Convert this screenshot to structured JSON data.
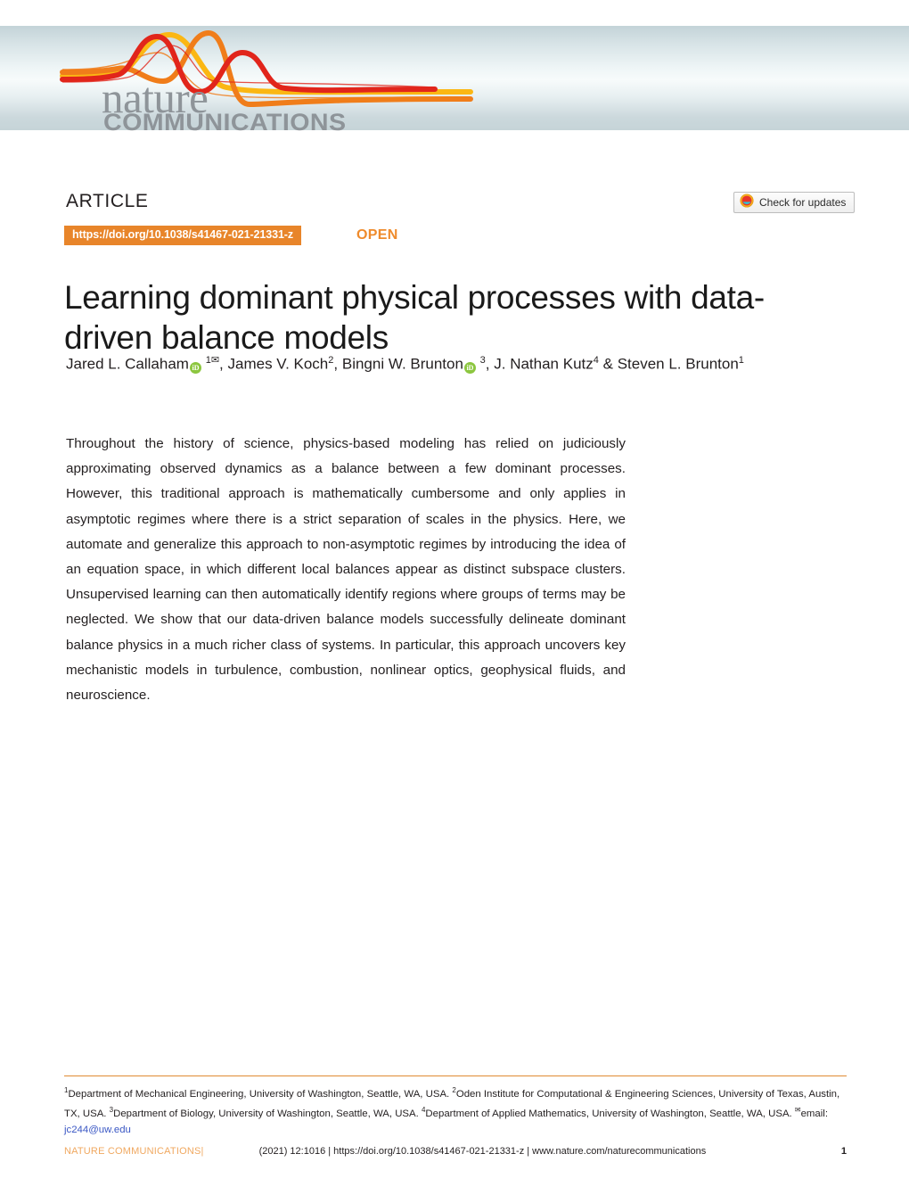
{
  "masthead": {
    "brand_primary": "nature",
    "brand_secondary": "COMMUNICATIONS",
    "wave_colors": [
      "#e1251b",
      "#f07d1a",
      "#fbb713"
    ]
  },
  "header": {
    "article_label": "ARTICLE",
    "doi_badge": "https://doi.org/10.1038/s41467-021-21331-z",
    "access_label": "OPEN",
    "check_updates_label": "Check for updates",
    "badge_color": "#e8852a",
    "open_color": "#ef8b2c"
  },
  "title": "Learning dominant physical processes with data-driven balance models",
  "authors": {
    "list": [
      {
        "name": "Jared L. Callaham",
        "orcid": true,
        "affiliations": "1",
        "corresponding": true
      },
      {
        "name": "James V. Koch",
        "orcid": false,
        "affiliations": "2",
        "corresponding": false
      },
      {
        "name": "Bingni W. Brunton",
        "orcid": true,
        "affiliations": "3",
        "corresponding": false
      },
      {
        "name": "J. Nathan Kutz",
        "orcid": false,
        "affiliations": "4",
        "corresponding": false
      },
      {
        "name": "Steven L. Brunton",
        "orcid": false,
        "affiliations": "1",
        "corresponding": false
      }
    ],
    "orcid_glyph": "iD",
    "envelope_glyph": "✉",
    "orcid_color": "#8cc63f"
  },
  "abstract": "Throughout the history of science, physics-based modeling has relied on judiciously approximating observed dynamics as a balance between a few dominant processes. However, this traditional approach is mathematically cumbersome and only applies in asymptotic regimes where there is a strict separation of scales in the physics. Here, we automate and generalize this approach to non-asymptotic regimes by introducing the idea of an equation space, in which different local balances appear as distinct subspace clusters. Unsupervised learning can then automatically identify regions where groups of terms may be neglected. We show that our data-driven balance models successfully delineate dominant balance physics in a much richer class of systems. In particular, this approach uncovers key mechanistic models in turbulence, combustion, nonlinear optics, geophysical fluids, and neuroscience.",
  "affiliations": {
    "entries": [
      {
        "marker": "1",
        "text": "Department of Mechanical Engineering, University of Washington, Seattle, WA, USA."
      },
      {
        "marker": "2",
        "text": "Oden Institute for Computational & Engineering Sciences, University of Texas, Austin, TX, USA."
      },
      {
        "marker": "3",
        "text": "Department of Biology, University of Washington, Seattle, WA, USA."
      },
      {
        "marker": "4",
        "text": "Department of Applied Mathematics, University of Washington, Seattle, WA, USA."
      }
    ],
    "email_prefix": "email:",
    "email": "jc244@uw.edu",
    "email_color": "#3a57c4",
    "rule_color": "#e08b33"
  },
  "footer": {
    "brand": "NATURE COMMUNICATIONS|",
    "citation": "(2021) 12:1016   | https://doi.org/10.1038/s41467-021-21331-z | www.nature.com/naturecommunications",
    "page_number": "1",
    "brand_color": "#f0a860"
  }
}
